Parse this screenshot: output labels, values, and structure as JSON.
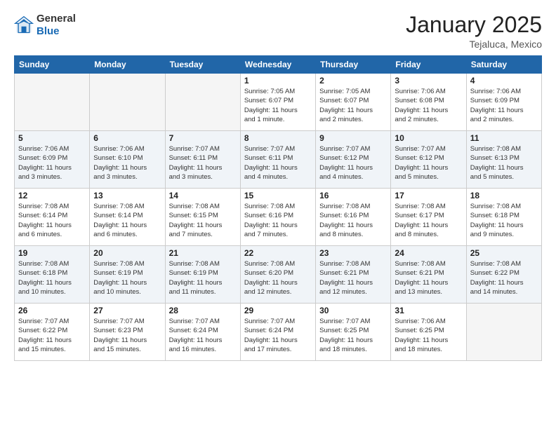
{
  "logo": {
    "general": "General",
    "blue": "Blue"
  },
  "header": {
    "month": "January 2025",
    "location": "Tejaluca, Mexico"
  },
  "days_of_week": [
    "Sunday",
    "Monday",
    "Tuesday",
    "Wednesday",
    "Thursday",
    "Friday",
    "Saturday"
  ],
  "weeks": [
    [
      {
        "day": "",
        "info": ""
      },
      {
        "day": "",
        "info": ""
      },
      {
        "day": "",
        "info": ""
      },
      {
        "day": "1",
        "info": "Sunrise: 7:05 AM\nSunset: 6:07 PM\nDaylight: 11 hours\nand 1 minute."
      },
      {
        "day": "2",
        "info": "Sunrise: 7:05 AM\nSunset: 6:07 PM\nDaylight: 11 hours\nand 2 minutes."
      },
      {
        "day": "3",
        "info": "Sunrise: 7:06 AM\nSunset: 6:08 PM\nDaylight: 11 hours\nand 2 minutes."
      },
      {
        "day": "4",
        "info": "Sunrise: 7:06 AM\nSunset: 6:09 PM\nDaylight: 11 hours\nand 2 minutes."
      }
    ],
    [
      {
        "day": "5",
        "info": "Sunrise: 7:06 AM\nSunset: 6:09 PM\nDaylight: 11 hours\nand 3 minutes."
      },
      {
        "day": "6",
        "info": "Sunrise: 7:06 AM\nSunset: 6:10 PM\nDaylight: 11 hours\nand 3 minutes."
      },
      {
        "day": "7",
        "info": "Sunrise: 7:07 AM\nSunset: 6:11 PM\nDaylight: 11 hours\nand 3 minutes."
      },
      {
        "day": "8",
        "info": "Sunrise: 7:07 AM\nSunset: 6:11 PM\nDaylight: 11 hours\nand 4 minutes."
      },
      {
        "day": "9",
        "info": "Sunrise: 7:07 AM\nSunset: 6:12 PM\nDaylight: 11 hours\nand 4 minutes."
      },
      {
        "day": "10",
        "info": "Sunrise: 7:07 AM\nSunset: 6:12 PM\nDaylight: 11 hours\nand 5 minutes."
      },
      {
        "day": "11",
        "info": "Sunrise: 7:08 AM\nSunset: 6:13 PM\nDaylight: 11 hours\nand 5 minutes."
      }
    ],
    [
      {
        "day": "12",
        "info": "Sunrise: 7:08 AM\nSunset: 6:14 PM\nDaylight: 11 hours\nand 6 minutes."
      },
      {
        "day": "13",
        "info": "Sunrise: 7:08 AM\nSunset: 6:14 PM\nDaylight: 11 hours\nand 6 minutes."
      },
      {
        "day": "14",
        "info": "Sunrise: 7:08 AM\nSunset: 6:15 PM\nDaylight: 11 hours\nand 7 minutes."
      },
      {
        "day": "15",
        "info": "Sunrise: 7:08 AM\nSunset: 6:16 PM\nDaylight: 11 hours\nand 7 minutes."
      },
      {
        "day": "16",
        "info": "Sunrise: 7:08 AM\nSunset: 6:16 PM\nDaylight: 11 hours\nand 8 minutes."
      },
      {
        "day": "17",
        "info": "Sunrise: 7:08 AM\nSunset: 6:17 PM\nDaylight: 11 hours\nand 8 minutes."
      },
      {
        "day": "18",
        "info": "Sunrise: 7:08 AM\nSunset: 6:18 PM\nDaylight: 11 hours\nand 9 minutes."
      }
    ],
    [
      {
        "day": "19",
        "info": "Sunrise: 7:08 AM\nSunset: 6:18 PM\nDaylight: 11 hours\nand 10 minutes."
      },
      {
        "day": "20",
        "info": "Sunrise: 7:08 AM\nSunset: 6:19 PM\nDaylight: 11 hours\nand 10 minutes."
      },
      {
        "day": "21",
        "info": "Sunrise: 7:08 AM\nSunset: 6:19 PM\nDaylight: 11 hours\nand 11 minutes."
      },
      {
        "day": "22",
        "info": "Sunrise: 7:08 AM\nSunset: 6:20 PM\nDaylight: 11 hours\nand 12 minutes."
      },
      {
        "day": "23",
        "info": "Sunrise: 7:08 AM\nSunset: 6:21 PM\nDaylight: 11 hours\nand 12 minutes."
      },
      {
        "day": "24",
        "info": "Sunrise: 7:08 AM\nSunset: 6:21 PM\nDaylight: 11 hours\nand 13 minutes."
      },
      {
        "day": "25",
        "info": "Sunrise: 7:08 AM\nSunset: 6:22 PM\nDaylight: 11 hours\nand 14 minutes."
      }
    ],
    [
      {
        "day": "26",
        "info": "Sunrise: 7:07 AM\nSunset: 6:22 PM\nDaylight: 11 hours\nand 15 minutes."
      },
      {
        "day": "27",
        "info": "Sunrise: 7:07 AM\nSunset: 6:23 PM\nDaylight: 11 hours\nand 15 minutes."
      },
      {
        "day": "28",
        "info": "Sunrise: 7:07 AM\nSunset: 6:24 PM\nDaylight: 11 hours\nand 16 minutes."
      },
      {
        "day": "29",
        "info": "Sunrise: 7:07 AM\nSunset: 6:24 PM\nDaylight: 11 hours\nand 17 minutes."
      },
      {
        "day": "30",
        "info": "Sunrise: 7:07 AM\nSunset: 6:25 PM\nDaylight: 11 hours\nand 18 minutes."
      },
      {
        "day": "31",
        "info": "Sunrise: 7:06 AM\nSunset: 6:25 PM\nDaylight: 11 hours\nand 18 minutes."
      },
      {
        "day": "",
        "info": ""
      }
    ]
  ]
}
